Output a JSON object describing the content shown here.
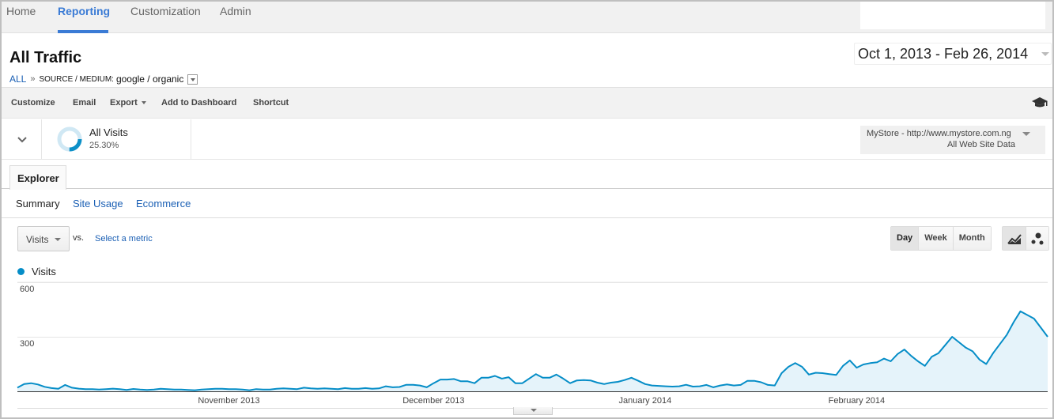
{
  "nav": {
    "items": [
      {
        "label": "Home",
        "active": false
      },
      {
        "label": "Reporting",
        "active": true
      },
      {
        "label": "Customization",
        "active": false
      },
      {
        "label": "Admin",
        "active": false
      }
    ]
  },
  "header": {
    "title": "All Traffic",
    "breadcrumb": {
      "root": "ALL",
      "separator": "»",
      "dimension_label": "SOURCE / MEDIUM:",
      "dimension_value": "google / organic"
    },
    "date_range": "Oct 1, 2013 - Feb 26, 2014"
  },
  "toolbar": {
    "customize": "Customize",
    "email": "Email",
    "export": "Export",
    "add_to_dashboard": "Add to Dashboard",
    "shortcut": "Shortcut",
    "help_icon": "graduation-cap-icon"
  },
  "segment": {
    "name": "All Visits",
    "percent": "25.30%",
    "percent_value": 0.253
  },
  "profile": {
    "line1": "MyStore - http://www.mystore.com.ng",
    "line2": "All Web Site Data"
  },
  "tabs": {
    "explorer": "Explorer"
  },
  "subtabs": [
    {
      "label": "Summary",
      "active": true
    },
    {
      "label": "Site Usage",
      "active": false
    },
    {
      "label": "Ecommerce",
      "active": false
    }
  ],
  "metric": {
    "selected": "Visits",
    "vs": "vs.",
    "select_metric": "Select a metric"
  },
  "granularity": [
    {
      "label": "Day",
      "active": true
    },
    {
      "label": "Week",
      "active": false
    },
    {
      "label": "Month",
      "active": false
    }
  ],
  "chart_types": [
    "line-chart-icon",
    "motion-chart-icon"
  ],
  "colors": {
    "accent": "#3a7bd5",
    "series": "#058dc7",
    "series_fill": "#e5f3fa",
    "link": "#1a5fb4"
  },
  "chart_data": {
    "type": "area",
    "title": "",
    "legend": [
      "Visits"
    ],
    "legend_position": "top-left",
    "xlabel": "",
    "ylabel": "",
    "ylim": [
      0,
      600
    ],
    "yticks": [
      300,
      600
    ],
    "ytick_labels": [
      "300",
      "600"
    ],
    "grid": true,
    "x_start": "2013-10-01",
    "x_end": "2014-02-26",
    "x_tick_labels": [
      {
        "label": "November 2013",
        "day_index": 31
      },
      {
        "label": "December 2013",
        "day_index": 61
      },
      {
        "label": "January 2014",
        "day_index": 92
      },
      {
        "label": "February 2014",
        "day_index": 123
      }
    ],
    "series": [
      {
        "name": "Visits",
        "values": [
          20,
          40,
          45,
          38,
          25,
          18,
          14,
          35,
          20,
          15,
          12,
          12,
          10,
          12,
          15,
          12,
          8,
          13,
          10,
          8,
          10,
          14,
          12,
          10,
          10,
          8,
          6,
          10,
          12,
          14,
          14,
          12,
          12,
          10,
          6,
          12,
          10,
          10,
          14,
          16,
          14,
          12,
          20,
          16,
          14,
          16,
          14,
          12,
          18,
          14,
          14,
          18,
          14,
          16,
          28,
          22,
          24,
          36,
          36,
          32,
          22,
          45,
          65,
          65,
          68,
          55,
          55,
          45,
          75,
          75,
          85,
          70,
          78,
          45,
          45,
          70,
          95,
          75,
          75,
          92,
          70,
          45,
          60,
          62,
          60,
          48,
          40,
          48,
          52,
          62,
          75,
          58,
          40,
          32,
          30,
          28,
          26,
          28,
          36,
          26,
          28,
          35,
          22,
          32,
          38,
          32,
          35,
          58,
          58,
          50,
          35,
          32,
          100,
          135,
          155,
          135,
          92,
          102,
          100,
          95,
          90,
          140,
          170,
          130,
          148,
          155,
          160,
          180,
          165,
          205,
          230,
          195,
          165,
          140,
          190,
          210,
          255,
          300,
          270,
          240,
          220,
          175,
          150,
          210,
          260,
          310,
          380,
          440,
          420,
          400,
          350,
          300
        ]
      }
    ]
  }
}
